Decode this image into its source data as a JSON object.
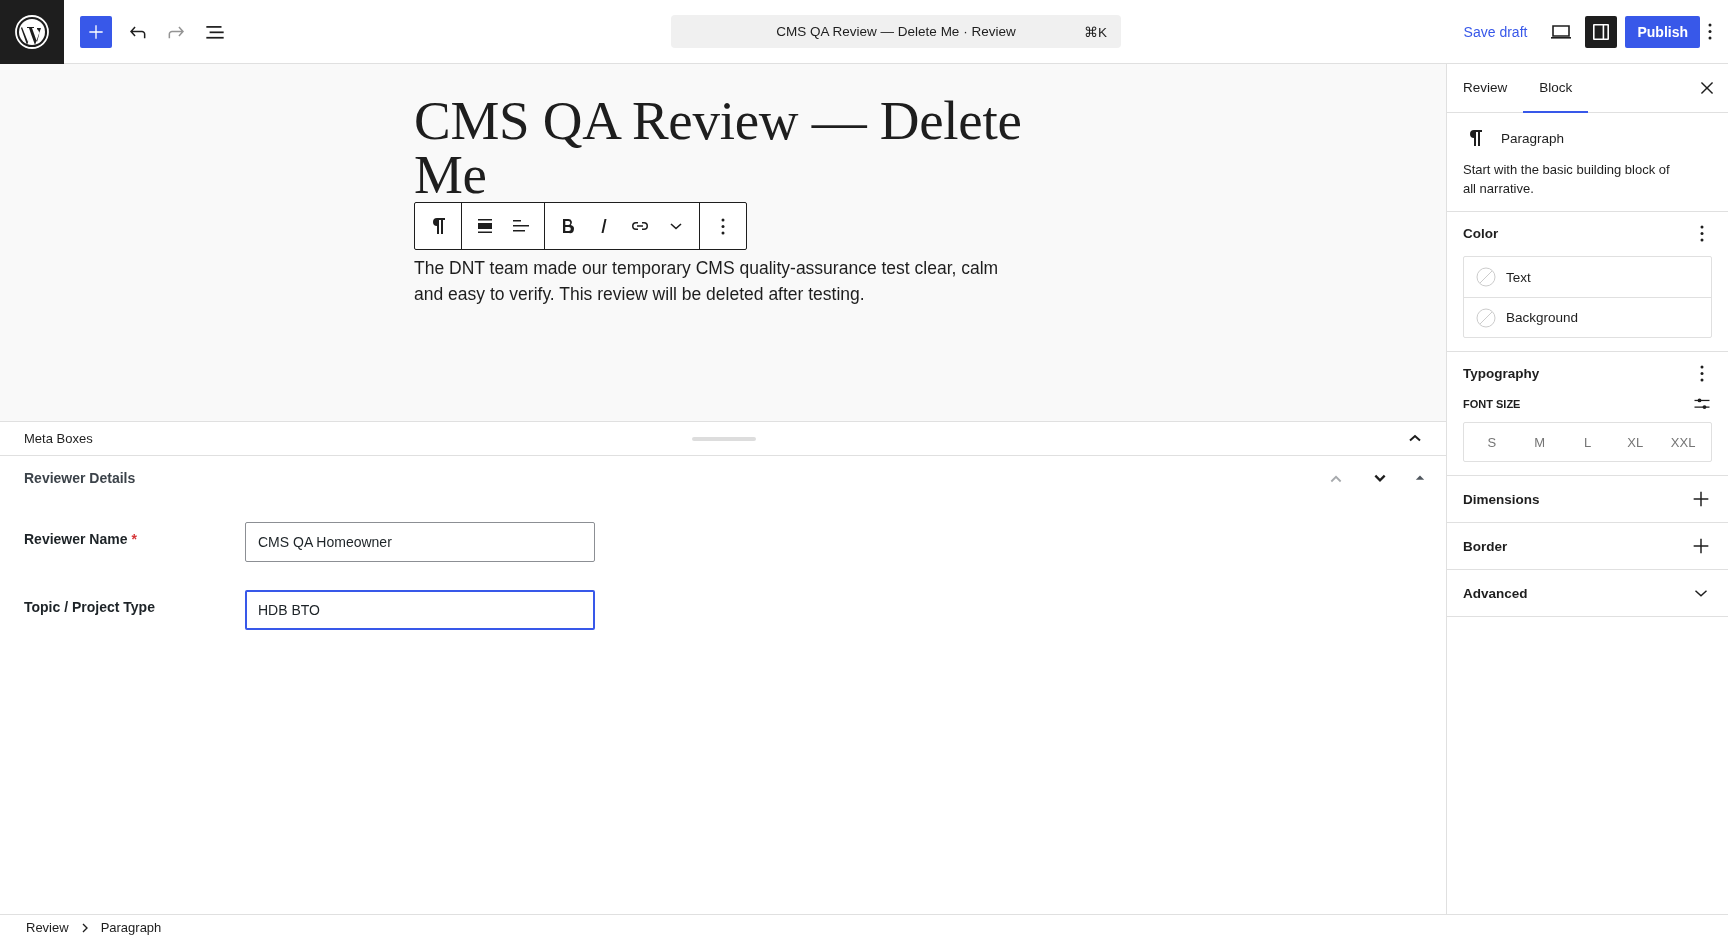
{
  "topbar": {
    "command": {
      "title": "CMS QA Review — Delete Me · Review",
      "shortcut": "⌘K"
    },
    "save_draft": "Save draft",
    "settings_open": true,
    "publish": "Publish"
  },
  "editor": {
    "title": "CMS QA Review — Delete Me",
    "paragraph": "The DNT team made our temporary CMS quality-assurance test clear, calm and easy to verify. This review will be deleted after testing."
  },
  "meta_boxes": {
    "label": "Meta Boxes",
    "expanded": true,
    "panel": {
      "title": "Reviewer Details",
      "fields": [
        {
          "label": "Reviewer Name",
          "required_mark": "*",
          "value": "CMS QA Homeowner",
          "focused": false
        },
        {
          "label": "Topic / Project Type",
          "value": "HDB BTO",
          "focused": true
        }
      ]
    }
  },
  "sidebar": {
    "tabs": [
      {
        "label": "Review",
        "selected": false
      },
      {
        "label": "Block",
        "selected": true
      }
    ],
    "block": {
      "name": "Paragraph",
      "description": "Start with the basic building block of all narrative."
    },
    "panels": [
      {
        "kind": "color",
        "title": "Color",
        "items": [
          {
            "label": "Text"
          },
          {
            "label": "Background"
          }
        ]
      },
      {
        "kind": "typography",
        "title": "Typography",
        "font_size_label": "FONT SIZE",
        "sizes": [
          {
            "label": "S",
            "selected": false
          },
          {
            "label": "M",
            "selected": false
          },
          {
            "label": "L",
            "selected": false
          },
          {
            "label": "XL",
            "selected": false
          },
          {
            "label": "XXL",
            "selected": false
          }
        ]
      },
      {
        "kind": "add",
        "title": "Dimensions"
      },
      {
        "kind": "add",
        "title": "Border"
      },
      {
        "kind": "collapsible",
        "title": "Advanced"
      }
    ]
  },
  "breadcrumb": [
    "Review",
    "Paragraph"
  ]
}
